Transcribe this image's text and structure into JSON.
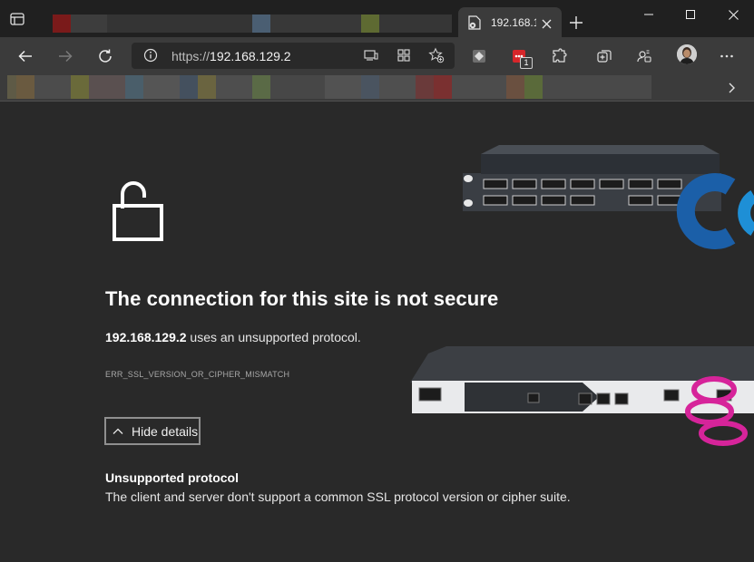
{
  "tabs": {
    "active": {
      "title": "192.168.1",
      "favicon": "document-error-icon"
    }
  },
  "toolbar": {
    "url_scheme": "https://",
    "url_host": "192.168.129.2",
    "extension_badge": "1"
  },
  "error": {
    "heading": "The connection for this site is not secure",
    "host": "192.168.129.2",
    "message": " uses an unsupported protocol.",
    "code": "ERR_SSL_VERSION_OR_CIPHER_MISMATCH",
    "toggle_label": "Hide details",
    "detail_title": "Unsupported protocol",
    "detail_text": "The client and server don't support a common SSL protocol version or cipher suite."
  },
  "colors": {
    "background": "#292929",
    "toolbar": "#3b3b3b",
    "tabstrip": "#202020",
    "device_logo_blue": "#1b5fa8",
    "device_logo_magenta": "#d6249a"
  }
}
